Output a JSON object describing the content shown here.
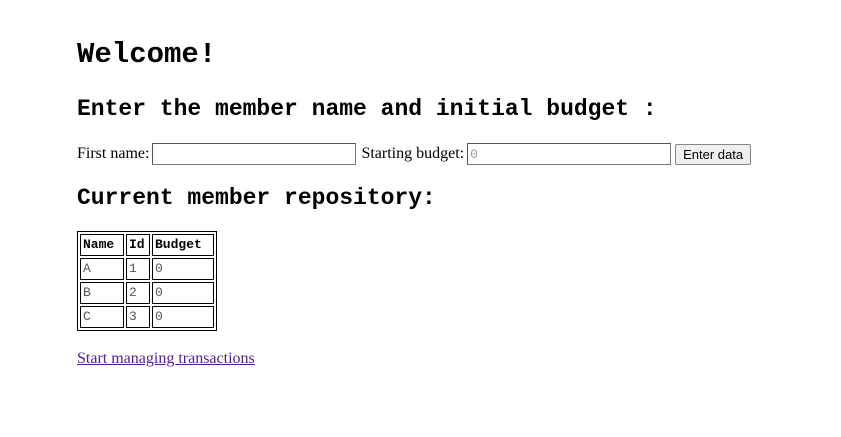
{
  "header": {
    "title": "Welcome!"
  },
  "form": {
    "heading": "Enter the member name and initial budget :",
    "first_name_label": "First name:",
    "first_name_value": "",
    "starting_budget_label": "Starting budget:",
    "starting_budget_placeholder": "0",
    "submit_label": "Enter data"
  },
  "repository": {
    "heading": "Current member repository:",
    "columns": [
      "Name",
      "Id",
      "Budget"
    ],
    "rows": [
      {
        "name": "A",
        "id": "1",
        "budget": "0"
      },
      {
        "name": "B",
        "id": "2",
        "budget": "0"
      },
      {
        "name": "C",
        "id": "3",
        "budget": "0"
      }
    ]
  },
  "footer": {
    "link_text": "Start managing transactions"
  },
  "colors": {
    "visited_link": "#551a8b",
    "cell_text": "#555555"
  }
}
